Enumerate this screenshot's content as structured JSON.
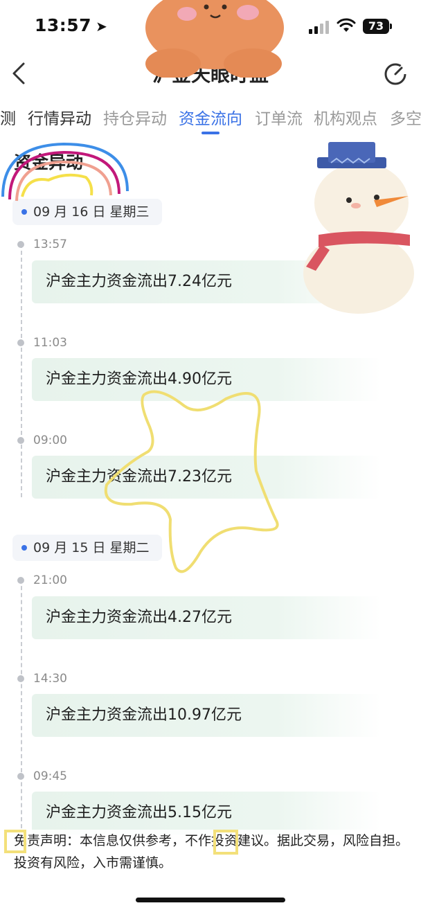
{
  "status_bar": {
    "time": "13:57",
    "battery": "73"
  },
  "header": {
    "title": "沪金天眼盯盘"
  },
  "tabs": [
    {
      "label": "测",
      "state": "normal"
    },
    {
      "label": "行情异动",
      "state": "normal"
    },
    {
      "label": "持仓异动",
      "state": "faded"
    },
    {
      "label": "资金流向",
      "state": "active"
    },
    {
      "label": "订单流",
      "state": "faded"
    },
    {
      "label": "机构观点",
      "state": "faded"
    },
    {
      "label": "多空",
      "state": "faded"
    }
  ],
  "section_title": "资金异动",
  "groups": [
    {
      "date": "09 月 16 日 星期三",
      "items": [
        {
          "time": "13:57",
          "text": "沪金主力资金流出7.24亿元"
        },
        {
          "time": "11:03",
          "text": "沪金主力资金流出4.90亿元"
        },
        {
          "time": "09:00",
          "text": "沪金主力资金流出7.23亿元"
        }
      ]
    },
    {
      "date": "09 月 15 日 星期二",
      "items": [
        {
          "time": "21:00",
          "text": "沪金主力资金流出4.27亿元"
        },
        {
          "time": "14:30",
          "text": "沪金主力资金流出10.97亿元"
        },
        {
          "time": "09:45",
          "text": "沪金主力资金流出5.15亿元"
        }
      ]
    }
  ],
  "disclaimer": "免责声明：本信息仅供参考，不作投资建议。据此交易，风险自担。投资有风险，入市需谨慎。",
  "colors": {
    "accent": "#3a72e6",
    "card_bg": "#e7f3ec",
    "timeline": "#c9ccd2"
  }
}
